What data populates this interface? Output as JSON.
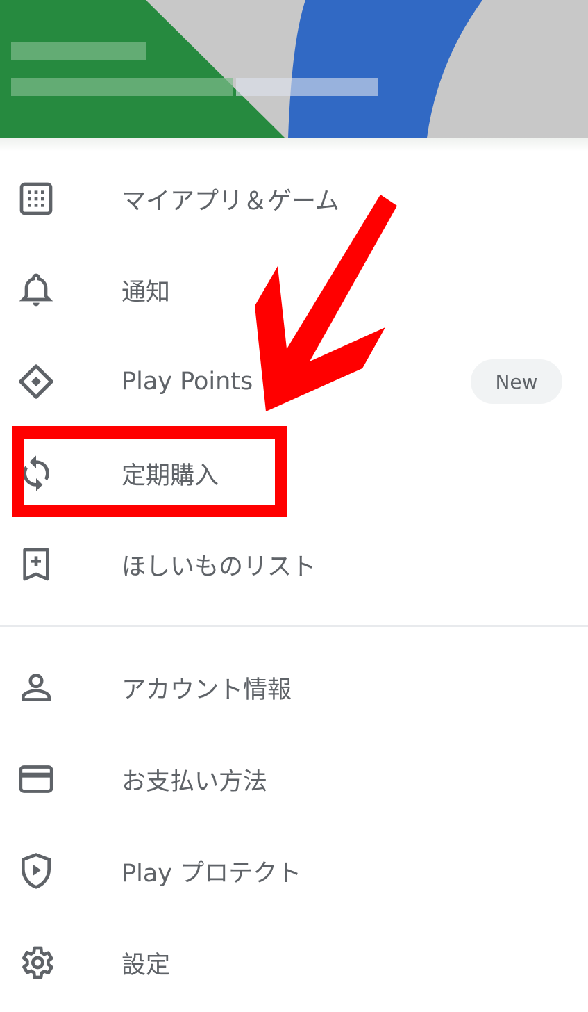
{
  "menu": {
    "primary": [
      {
        "label": "マイアプリ＆ゲーム",
        "icon": "apps-grid-icon"
      },
      {
        "label": "通知",
        "icon": "bell-icon"
      },
      {
        "label": "Play Points",
        "icon": "diamond-icon",
        "badge": "New"
      },
      {
        "label": "定期購入",
        "icon": "sync-icon"
      },
      {
        "label": "ほしいものリスト",
        "icon": "bookmark-add-icon"
      }
    ],
    "secondary": [
      {
        "label": "アカウント情報",
        "icon": "person-icon"
      },
      {
        "label": "お支払い方法",
        "icon": "credit-card-icon"
      },
      {
        "label": "Play プロテクト",
        "icon": "shield-play-icon"
      },
      {
        "label": "設定",
        "icon": "gear-icon"
      }
    ]
  },
  "colors": {
    "text": "#5f6368",
    "annotation": "#ff0000",
    "header_green": "#268a3f",
    "header_blue": "#3169c4"
  }
}
